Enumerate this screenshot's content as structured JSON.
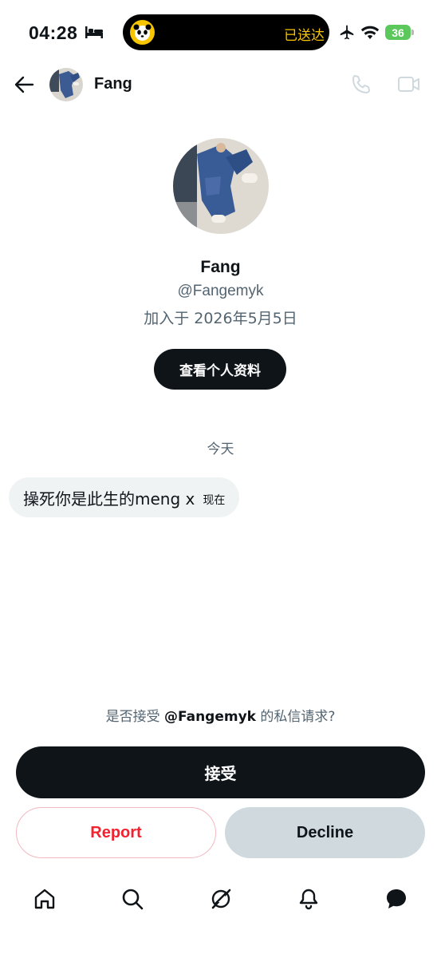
{
  "status_bar": {
    "time": "04:28",
    "island_text": "已送达",
    "battery": "36"
  },
  "header": {
    "name": "Fang"
  },
  "profile": {
    "name": "Fang",
    "handle": "@Fangemyk",
    "joined": "加入于 2026年5月5日",
    "view_profile_label": "查看个人资料"
  },
  "conversation": {
    "date_separator": "今天",
    "messages": [
      {
        "text": "操死你是此生的meng x",
        "time": "现在"
      }
    ]
  },
  "request": {
    "prompt_prefix": "是否接受 ",
    "prompt_handle": "@Fangemyk",
    "prompt_suffix": " 的私信请求?",
    "accept_label": "接受",
    "report_label": "Report",
    "decline_label": "Decline"
  },
  "bottom_nav": [
    "home-icon",
    "search-icon",
    "grok-icon",
    "notifications-icon",
    "messages-icon"
  ],
  "colors": {
    "accent_dark": "#0f1419",
    "secondary_text": "#536471",
    "report_red": "#f4212e",
    "decline_bg": "#cfd9de",
    "bubble_bg": "#eff3f4"
  }
}
